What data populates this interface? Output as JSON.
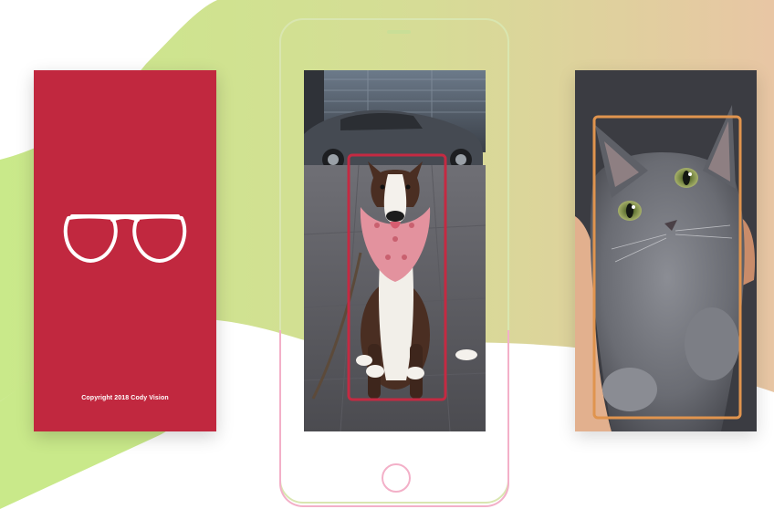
{
  "splash": {
    "copyright": "Copyright 2018 Cody Vision",
    "logo_icon": "aviator-sunglasses-icon",
    "background_color": "#c1283f"
  },
  "phone": {
    "photo_subject": "dog",
    "detection_box_color": "#c42a42",
    "frame_color_top": "#d9e6b0",
    "frame_color_bottom": "#f3b0c8"
  },
  "cat_card": {
    "photo_subject": "cat",
    "detection_box_color": "#e0944e"
  },
  "colors": {
    "green_wave": "#c9e98a",
    "tan_gradient_end": "#e6c7a3"
  }
}
